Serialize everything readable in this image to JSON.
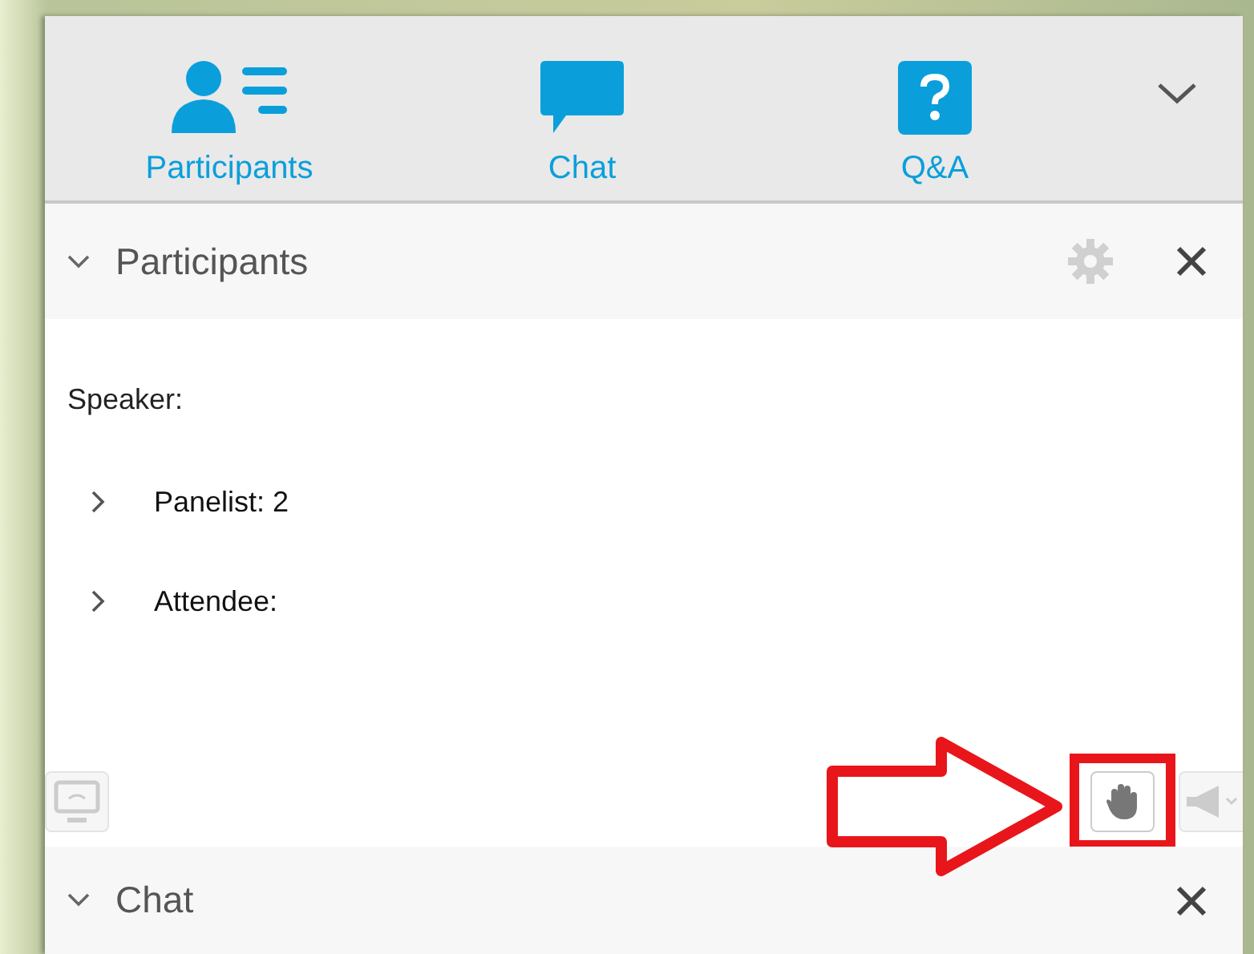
{
  "tabs": [
    {
      "label": "Participants",
      "kind": "participants"
    },
    {
      "label": "Chat",
      "kind": "chat"
    },
    {
      "label": "Q&A",
      "kind": "qa"
    }
  ],
  "participants_panel": {
    "title": "Participants",
    "expanded": true,
    "settings_disabled": true,
    "speaker_label": "Speaker:",
    "groups": [
      {
        "label": "Panelist: 2",
        "expanded": false
      },
      {
        "label": "Attendee:",
        "expanded": false
      }
    ],
    "toolbar": [
      {
        "kind": "share",
        "disabled": true,
        "highlighted": false
      },
      {
        "kind": "raise-hand",
        "disabled": false,
        "highlighted": true
      },
      {
        "kind": "mute-all",
        "disabled": true,
        "highlighted": false
      }
    ]
  },
  "chat_panel": {
    "title": "Chat",
    "expanded": true
  }
}
